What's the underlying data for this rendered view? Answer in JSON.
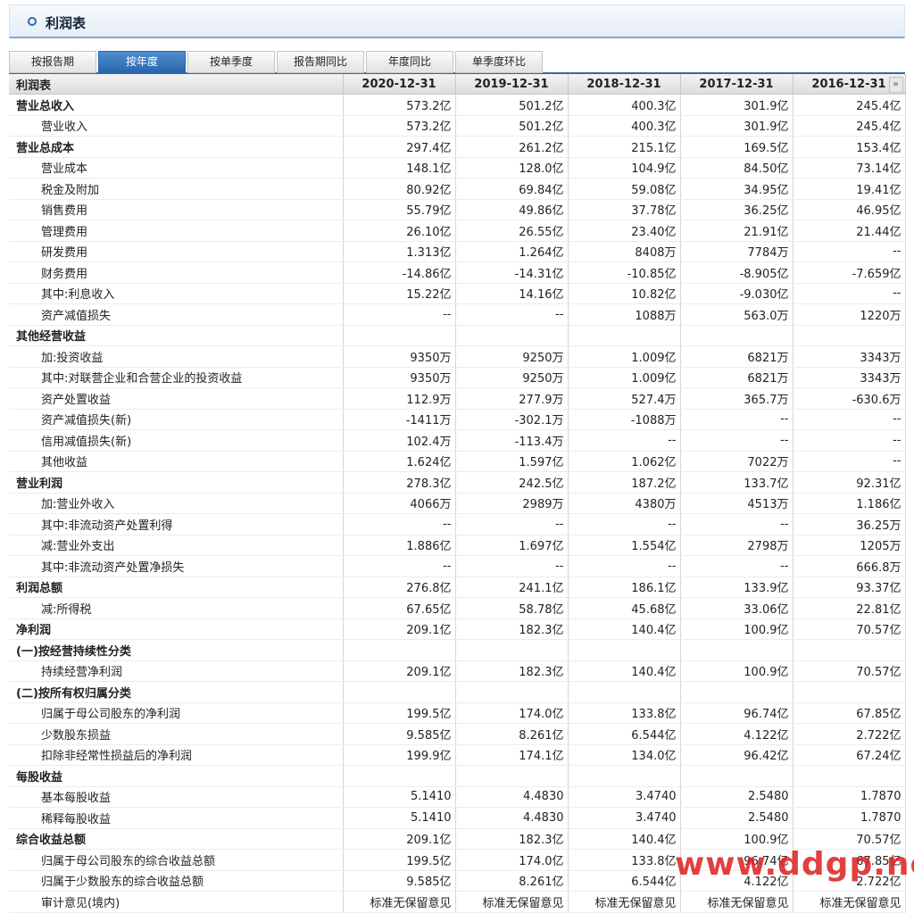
{
  "header": {
    "title": "利润表"
  },
  "tabs": [
    {
      "label": "按报告期",
      "active": false
    },
    {
      "label": "按年度",
      "active": true
    },
    {
      "label": "按单季度",
      "active": false
    },
    {
      "label": "报告期同比",
      "active": false
    },
    {
      "label": "年度同比",
      "active": false
    },
    {
      "label": "单季度环比",
      "active": false
    }
  ],
  "table": {
    "first_header": "利润表",
    "columns": [
      "2020-12-31",
      "2019-12-31",
      "2018-12-31",
      "2017-12-31",
      "2016-12-31"
    ],
    "scroll_glyph": "»",
    "rows": [
      {
        "label": "营业总收入",
        "type": "sec",
        "values": [
          "573.2亿",
          "501.2亿",
          "400.3亿",
          "301.9亿",
          "245.4亿"
        ]
      },
      {
        "label": "营业收入",
        "type": "sub",
        "values": [
          "573.2亿",
          "501.2亿",
          "400.3亿",
          "301.9亿",
          "245.4亿"
        ]
      },
      {
        "label": "营业总成本",
        "type": "sec",
        "values": [
          "297.4亿",
          "261.2亿",
          "215.1亿",
          "169.5亿",
          "153.4亿"
        ]
      },
      {
        "label": "营业成本",
        "type": "sub",
        "values": [
          "148.1亿",
          "128.0亿",
          "104.9亿",
          "84.50亿",
          "73.14亿"
        ]
      },
      {
        "label": "税金及附加",
        "type": "sub",
        "values": [
          "80.92亿",
          "69.84亿",
          "59.08亿",
          "34.95亿",
          "19.41亿"
        ]
      },
      {
        "label": "销售费用",
        "type": "sub",
        "values": [
          "55.79亿",
          "49.86亿",
          "37.78亿",
          "36.25亿",
          "46.95亿"
        ]
      },
      {
        "label": "管理费用",
        "type": "sub",
        "values": [
          "26.10亿",
          "26.55亿",
          "23.40亿",
          "21.91亿",
          "21.44亿"
        ]
      },
      {
        "label": "研发费用",
        "type": "sub",
        "values": [
          "1.313亿",
          "1.264亿",
          "8408万",
          "7784万",
          "--"
        ]
      },
      {
        "label": "财务费用",
        "type": "sub",
        "values": [
          "-14.86亿",
          "-14.31亿",
          "-10.85亿",
          "-8.905亿",
          "-7.659亿"
        ]
      },
      {
        "label": "其中:利息收入",
        "type": "sub",
        "values": [
          "15.22亿",
          "14.16亿",
          "10.82亿",
          "-9.030亿",
          "--"
        ]
      },
      {
        "label": "资产减值损失",
        "type": "sub",
        "values": [
          "--",
          "--",
          "1088万",
          "563.0万",
          "1220万"
        ]
      },
      {
        "label": "其他经营收益",
        "type": "sec",
        "values": [
          "",
          "",
          "",
          "",
          ""
        ]
      },
      {
        "label": "加:投资收益",
        "type": "sub",
        "values": [
          "9350万",
          "9250万",
          "1.009亿",
          "6821万",
          "3343万"
        ]
      },
      {
        "label": "其中:对联营企业和合营企业的投资收益",
        "type": "sub",
        "values": [
          "9350万",
          "9250万",
          "1.009亿",
          "6821万",
          "3343万"
        ]
      },
      {
        "label": "资产处置收益",
        "type": "sub",
        "values": [
          "112.9万",
          "277.9万",
          "527.4万",
          "365.7万",
          "-630.6万"
        ]
      },
      {
        "label": "资产减值损失(新)",
        "type": "sub",
        "values": [
          "-1411万",
          "-302.1万",
          "-1088万",
          "--",
          "--"
        ]
      },
      {
        "label": "信用减值损失(新)",
        "type": "sub",
        "values": [
          "102.4万",
          "-113.4万",
          "--",
          "--",
          "--"
        ]
      },
      {
        "label": "其他收益",
        "type": "sub",
        "values": [
          "1.624亿",
          "1.597亿",
          "1.062亿",
          "7022万",
          "--"
        ]
      },
      {
        "label": "营业利润",
        "type": "sec",
        "values": [
          "278.3亿",
          "242.5亿",
          "187.2亿",
          "133.7亿",
          "92.31亿"
        ]
      },
      {
        "label": "加:营业外收入",
        "type": "sub",
        "values": [
          "4066万",
          "2989万",
          "4380万",
          "4513万",
          "1.186亿"
        ]
      },
      {
        "label": "其中:非流动资产处置利得",
        "type": "sub",
        "values": [
          "--",
          "--",
          "--",
          "--",
          "36.25万"
        ]
      },
      {
        "label": "减:营业外支出",
        "type": "sub",
        "values": [
          "1.886亿",
          "1.697亿",
          "1.554亿",
          "2798万",
          "1205万"
        ]
      },
      {
        "label": "其中:非流动资产处置净损失",
        "type": "sub",
        "values": [
          "--",
          "--",
          "--",
          "--",
          "666.8万"
        ]
      },
      {
        "label": "利润总额",
        "type": "sec",
        "values": [
          "276.8亿",
          "241.1亿",
          "186.1亿",
          "133.9亿",
          "93.37亿"
        ]
      },
      {
        "label": "减:所得税",
        "type": "sub",
        "values": [
          "67.65亿",
          "58.78亿",
          "45.68亿",
          "33.06亿",
          "22.81亿"
        ]
      },
      {
        "label": "净利润",
        "type": "sec",
        "values": [
          "209.1亿",
          "182.3亿",
          "140.4亿",
          "100.9亿",
          "70.57亿"
        ]
      },
      {
        "label": "(一)按经营持续性分类",
        "type": "sec",
        "values": [
          "",
          "",
          "",
          "",
          ""
        ]
      },
      {
        "label": "持续经营净利润",
        "type": "sub",
        "values": [
          "209.1亿",
          "182.3亿",
          "140.4亿",
          "100.9亿",
          "70.57亿"
        ]
      },
      {
        "label": "(二)按所有权归属分类",
        "type": "sec",
        "values": [
          "",
          "",
          "",
          "",
          ""
        ]
      },
      {
        "label": "归属于母公司股东的净利润",
        "type": "sub",
        "values": [
          "199.5亿",
          "174.0亿",
          "133.8亿",
          "96.74亿",
          "67.85亿"
        ]
      },
      {
        "label": "少数股东损益",
        "type": "sub",
        "values": [
          "9.585亿",
          "8.261亿",
          "6.544亿",
          "4.122亿",
          "2.722亿"
        ]
      },
      {
        "label": "扣除非经常性损益后的净利润",
        "type": "sub",
        "values": [
          "199.9亿",
          "174.1亿",
          "134.0亿",
          "96.42亿",
          "67.24亿"
        ]
      },
      {
        "label": "每股收益",
        "type": "sec",
        "values": [
          "",
          "",
          "",
          "",
          ""
        ]
      },
      {
        "label": "基本每股收益",
        "type": "sub",
        "values": [
          "5.1410",
          "4.4830",
          "3.4740",
          "2.5480",
          "1.7870"
        ]
      },
      {
        "label": "稀释每股收益",
        "type": "sub",
        "values": [
          "5.1410",
          "4.4830",
          "3.4740",
          "2.5480",
          "1.7870"
        ]
      },
      {
        "label": "综合收益总额",
        "type": "sec",
        "values": [
          "209.1亿",
          "182.3亿",
          "140.4亿",
          "100.9亿",
          "70.57亿"
        ]
      },
      {
        "label": "归属于母公司股东的综合收益总额",
        "type": "sub",
        "values": [
          "199.5亿",
          "174.0亿",
          "133.8亿",
          "96.74亿",
          "67.85亿"
        ]
      },
      {
        "label": "归属于少数股东的综合收益总额",
        "type": "sub",
        "values": [
          "9.585亿",
          "8.261亿",
          "6.544亿",
          "4.122亿",
          "2.722亿"
        ]
      },
      {
        "label": "审计意见(境内)",
        "type": "sub",
        "values": [
          "标准无保留意见",
          "标准无保留意见",
          "标准无保留意见",
          "标准无保留意见",
          "标准无保留意见"
        ]
      }
    ]
  },
  "watermark": "www.ddgp.net"
}
